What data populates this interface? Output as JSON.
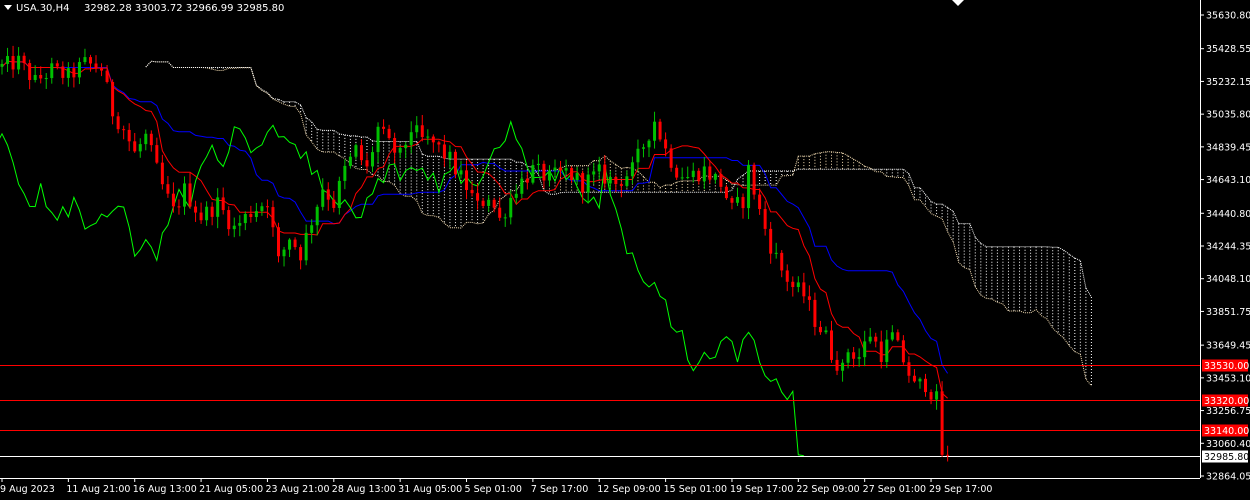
{
  "header": {
    "symbol": "USA.30,H4",
    "ohlc": "32982.28 33003.72 32966.99 32985.80"
  },
  "colors": {
    "background": "#000000",
    "text": "#ffffff",
    "bull": "#00c000",
    "bear": "#ff0000",
    "tenkan": "#ff0000",
    "kijun": "#0000ff",
    "chikou": "#00ff00",
    "cloud_bull": "#f5deb3",
    "cloud_bear": "#ffffff",
    "level": "#ff0000",
    "current": "#ffffff"
  },
  "chart_data": {
    "type": "candlestick",
    "indicator": "Ichimoku",
    "ylim": [
      32864.05,
      35630.8
    ],
    "y_ticks": [
      "35630.80",
      "35428.55",
      "35232.15",
      "35035.80",
      "34839.45",
      "34643.10",
      "34440.80",
      "34244.35",
      "34048.10",
      "33851.75",
      "33649.45",
      "33453.10",
      "33256.75",
      "33060.40",
      "32864.05"
    ],
    "x_ticks": [
      {
        "label": "9 Aug 2023",
        "bar": 0
      },
      {
        "label": "11 Aug 21:00",
        "bar": 12
      },
      {
        "label": "16 Aug 13:00",
        "bar": 24
      },
      {
        "label": "21 Aug 05:00",
        "bar": 36
      },
      {
        "label": "23 Aug 21:00",
        "bar": 48
      },
      {
        "label": "28 Aug 13:00",
        "bar": 60
      },
      {
        "label": "31 Aug 05:00",
        "bar": 72
      },
      {
        "label": "5 Sep 01:00",
        "bar": 84
      },
      {
        "label": "7 Sep 17:00",
        "bar": 96
      },
      {
        "label": "12 Sep 09:00",
        "bar": 108
      },
      {
        "label": "15 Sep 01:00",
        "bar": 120
      },
      {
        "label": "19 Sep 17:00",
        "bar": 132
      },
      {
        "label": "22 Sep 09:00",
        "bar": 144
      },
      {
        "label": "27 Sep 01:00",
        "bar": 156
      },
      {
        "label": "29 Sep 17:00",
        "bar": 168
      }
    ],
    "levels": [
      {
        "value": 33530.0,
        "label": "33530.00"
      },
      {
        "value": 33320.0,
        "label": "33320.00"
      },
      {
        "value": 33140.0,
        "label": "33140.00"
      }
    ],
    "current_price": {
      "value": 32985.8,
      "label": "32985.80"
    },
    "close_path": [
      [
        0,
        35320
      ],
      [
        3,
        35350
      ],
      [
        6,
        35230
      ],
      [
        9,
        35300
      ],
      [
        12,
        35260
      ],
      [
        15,
        35340
      ],
      [
        18,
        35310
      ],
      [
        20,
        35050
      ],
      [
        22,
        34950
      ],
      [
        24,
        34800
      ],
      [
        26,
        34900
      ],
      [
        29,
        34600
      ],
      [
        31,
        34450
      ],
      [
        33,
        34580
      ],
      [
        36,
        34420
      ],
      [
        39,
        34500
      ],
      [
        42,
        34350
      ],
      [
        45,
        34450
      ],
      [
        48,
        34520
      ],
      [
        50,
        34150
      ],
      [
        52,
        34300
      ],
      [
        54,
        34200
      ],
      [
        56,
        34400
      ],
      [
        58,
        34600
      ],
      [
        60,
        34500
      ],
      [
        62,
        34700
      ],
      [
        64,
        34820
      ],
      [
        66,
        34700
      ],
      [
        68,
        34950
      ],
      [
        70,
        34850
      ],
      [
        72,
        34780
      ],
      [
        74,
        34950
      ],
      [
        76,
        34880
      ],
      [
        78,
        34860
      ],
      [
        81,
        34760
      ],
      [
        84,
        34600
      ],
      [
        86,
        34480
      ],
      [
        88,
        34550
      ],
      [
        90,
        34400
      ],
      [
        93,
        34600
      ],
      [
        96,
        34700
      ],
      [
        99,
        34650
      ],
      [
        102,
        34690
      ],
      [
        105,
        34620
      ],
      [
        108,
        34680
      ],
      [
        111,
        34620
      ],
      [
        114,
        34700
      ],
      [
        116,
        34850
      ],
      [
        118,
        35000
      ],
      [
        120,
        34820
      ],
      [
        122,
        34700
      ],
      [
        124,
        34660
      ],
      [
        127,
        34700
      ],
      [
        130,
        34620
      ],
      [
        132,
        34460
      ],
      [
        134,
        34520
      ],
      [
        135,
        34700
      ],
      [
        137,
        34450
      ],
      [
        139,
        34250
      ],
      [
        141,
        34100
      ],
      [
        143,
        34000
      ],
      [
        145,
        33950
      ],
      [
        147,
        33800
      ],
      [
        149,
        33700
      ],
      [
        150,
        33600
      ],
      [
        152,
        33500
      ],
      [
        153,
        33620
      ],
      [
        155,
        33580
      ],
      [
        157,
        33720
      ],
      [
        159,
        33600
      ],
      [
        161,
        33700
      ],
      [
        163,
        33560
      ],
      [
        165,
        33400
      ],
      [
        167,
        33420
      ],
      [
        169,
        33320
      ],
      [
        170,
        33000
      ],
      [
        171,
        32986
      ]
    ]
  }
}
